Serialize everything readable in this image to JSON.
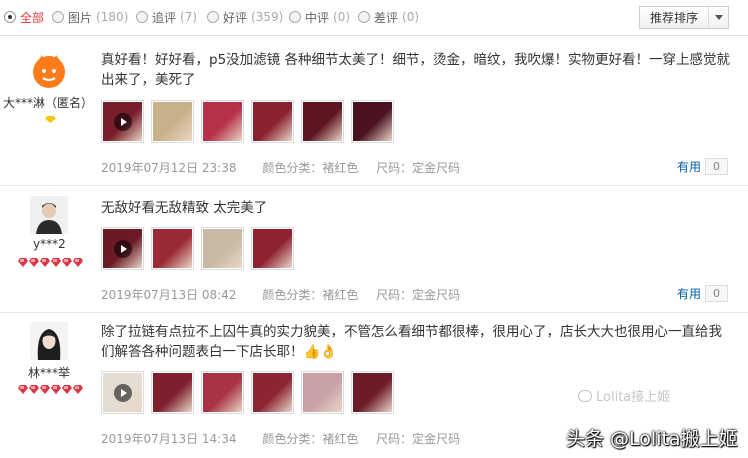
{
  "filters": [
    {
      "label": "全部",
      "count": "",
      "active": true
    },
    {
      "label": "图片",
      "count": "(180)",
      "active": false
    },
    {
      "label": "追评",
      "count": "(7)",
      "active": false
    },
    {
      "label": "好评",
      "count": "(359)",
      "active": false
    },
    {
      "label": "中评",
      "count": "(0)",
      "active": false
    },
    {
      "label": "差评",
      "count": "(0)",
      "active": false
    }
  ],
  "sort": {
    "label": "推荐排序"
  },
  "reviews": [
    {
      "user": "大***淋（匿名）",
      "text": "真好看！好好看，p5没加滤镜 各种细节太美了！细节，烫金，暗纹，我吹爆！实物更好看！一穿上感觉就出来了，美死了",
      "date": "2019年07月12日 23:38",
      "color": "颜色分类：褚红色",
      "size": "尺码：定金尺码",
      "helpful_label": "有用",
      "helpful_count": "0",
      "thumb_colors": [
        "#7a1d2a",
        "#c9b28a",
        "#b6314a",
        "#8a2030",
        "#5e1520",
        "#4a1220"
      ]
    },
    {
      "user": "y***2",
      "text": "无敌好看无敌精致 太完美了",
      "date": "2019年07月13日 08:42",
      "color": "颜色分类：褚红色",
      "size": "尺码：定金尺码",
      "helpful_label": "有用",
      "helpful_count": "0",
      "thumb_colors": [
        "#6b1a24",
        "#9a2a36",
        "#c7b9a4",
        "#8e2232"
      ]
    },
    {
      "user": "林***举",
      "text": "除了拉链有点拉不上囚牛真的实力貌美，不管怎么看细节都很棒，很用心了，店长大大也很用心一直给我们解答各种问题表白一下店长耶！👍👌",
      "date": "2019年07月13日 14:34",
      "color": "颜色分类：褚红色",
      "size": "尺码：定金尺码",
      "helpful_label": "有用",
      "helpful_count": "0",
      "thumb_colors": [
        "#e5dcd2",
        "#7d1f2c",
        "#a93244",
        "#8c2533",
        "#c9a0a6",
        "#6e1b28"
      ]
    }
  ],
  "watermark": {
    "small": "Lolita接上姬",
    "big": "头条 @Lolita搬上姬"
  },
  "colors": {
    "accent": "#e4393c",
    "link": "#005ea7",
    "gem": "#d73a47"
  }
}
